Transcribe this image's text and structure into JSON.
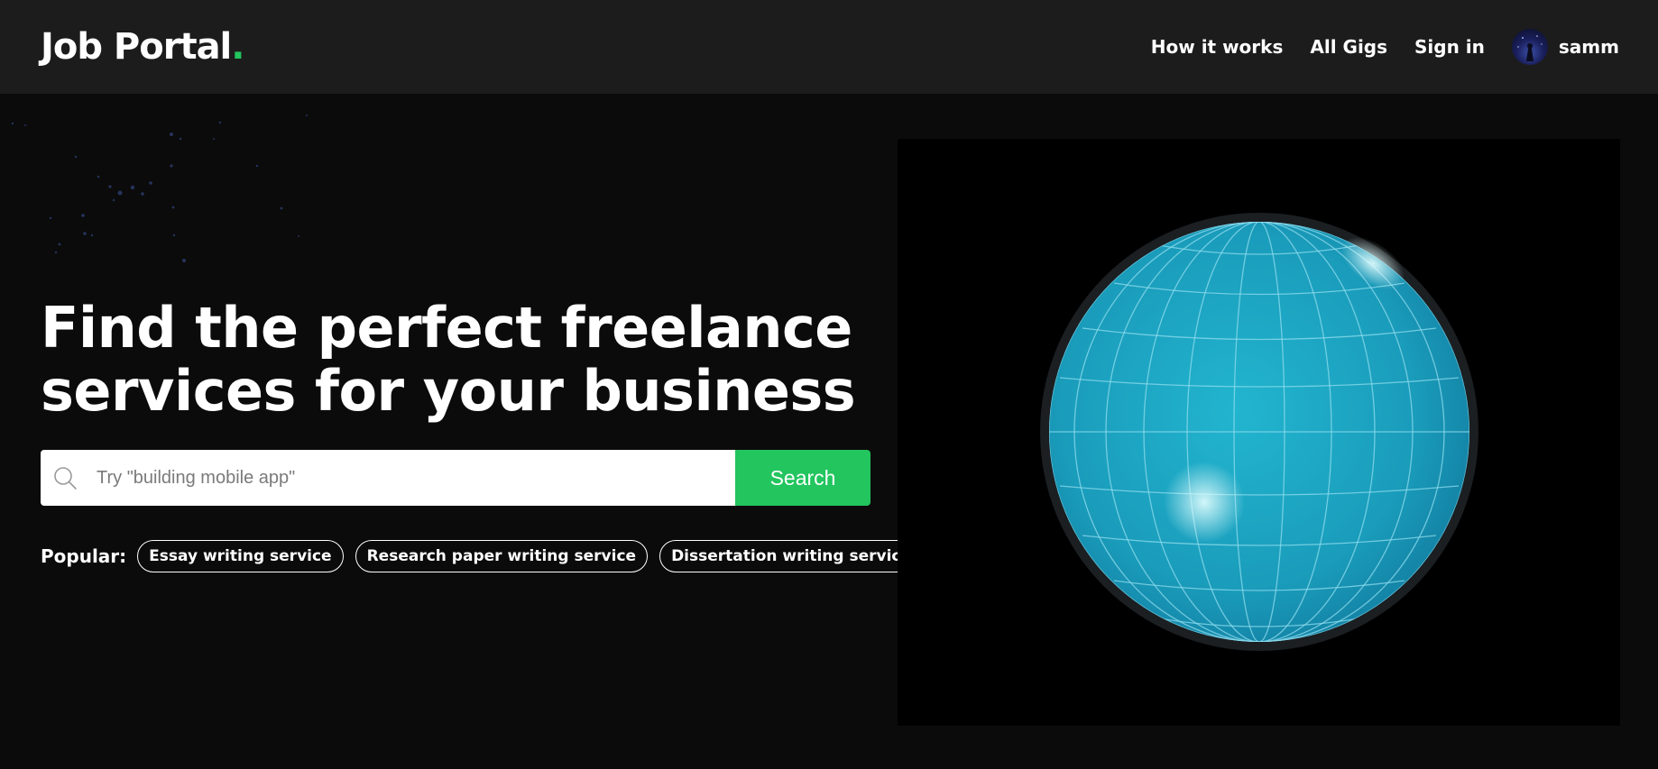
{
  "header": {
    "logo_text": "Job Portal",
    "logo_dot": ".",
    "nav": [
      {
        "label": "How it works"
      },
      {
        "label": "All Gigs"
      },
      {
        "label": "Sign in"
      }
    ],
    "user": {
      "name": "samm"
    }
  },
  "hero": {
    "headline_line1": "Find the perfect freelance",
    "headline_line2": "services for your business",
    "search": {
      "placeholder": "Try \"building mobile app\"",
      "value": "",
      "button_label": "Search"
    },
    "popular": {
      "label": "Popular:",
      "tags": [
        {
          "label": "Essay writing service"
        },
        {
          "label": "Research paper writing service"
        },
        {
          "label": "Dissertation writing service"
        }
      ]
    }
  },
  "colors": {
    "accent": "#22c55e",
    "page_bg": "#0b0b0b",
    "header_bg": "#1c1c1c",
    "globe": "#1ba3bf"
  },
  "icons": {
    "search": "search-icon",
    "avatar": "avatar",
    "globe": "globe-graphic"
  }
}
